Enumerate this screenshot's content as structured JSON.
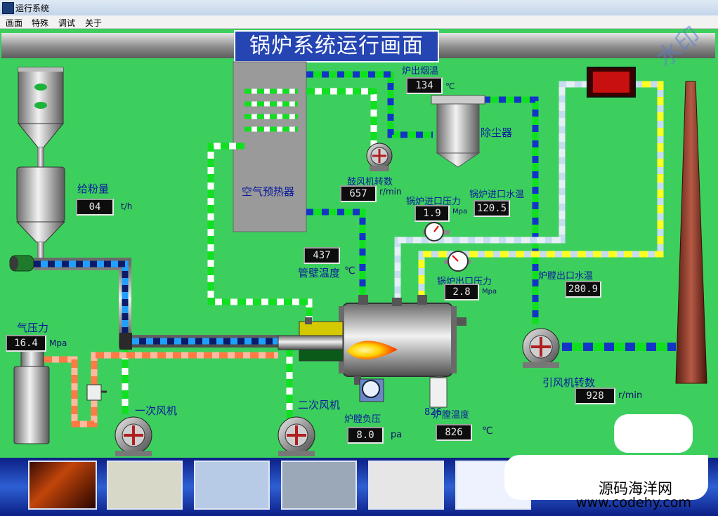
{
  "window": {
    "title": "运行系统"
  },
  "menu": [
    "画面",
    "特殊",
    "调试",
    "关于"
  ],
  "main_title": "锅炉系统运行画面",
  "equipment": {
    "preheater": "空气预热器",
    "dust_remover": "除尘器",
    "primary_fan": "一次风机",
    "secondary_fan": "二次风机",
    "induced_fan": "引风机转数"
  },
  "readings": {
    "powder_feed": {
      "label": "给粉量",
      "value": "04",
      "unit": "t/h"
    },
    "gas_pressure": {
      "label": "气压力",
      "value": "16.4",
      "unit": "Mpa"
    },
    "flue_temp": {
      "label": "炉出烟温",
      "value": "134",
      "unit": "℃"
    },
    "blower_speed": {
      "label": "鼓风机转数",
      "value": "657",
      "unit": "r/min"
    },
    "inlet_pressure": {
      "label": "锅炉进口压力",
      "value": "1.9",
      "unit": "Mpa"
    },
    "inlet_water_temp": {
      "label": "锅炉进口水温",
      "value": "120.5"
    },
    "wall_temp": {
      "label": "管壁温度",
      "value": "437",
      "unit": "℃"
    },
    "outlet_pressure": {
      "label": "锅炉出口压力",
      "value": "2.8",
      "unit": "Mpa"
    },
    "outlet_water_temp": {
      "label": "炉膛出口水温",
      "value": "280.9"
    },
    "induced_fan_speed": {
      "value": "928",
      "unit": "r/min"
    },
    "furnace_neg_pressure": {
      "label": "炉膛负压",
      "value": "8.0",
      "unit": "pa"
    },
    "furnace_temp": {
      "label": "炉膛温度",
      "value": "826",
      "unit": "℃"
    },
    "thermo_overlay": "826"
  },
  "watermark": {
    "site_cn": "源码海洋网",
    "site_url": "www.codehy.com",
    "vertical": "水印"
  },
  "colors": {
    "background": "#3dcf5e",
    "title_bg": "#2545b3",
    "label": "#0b1a9c",
    "flame": "#ffd400"
  }
}
